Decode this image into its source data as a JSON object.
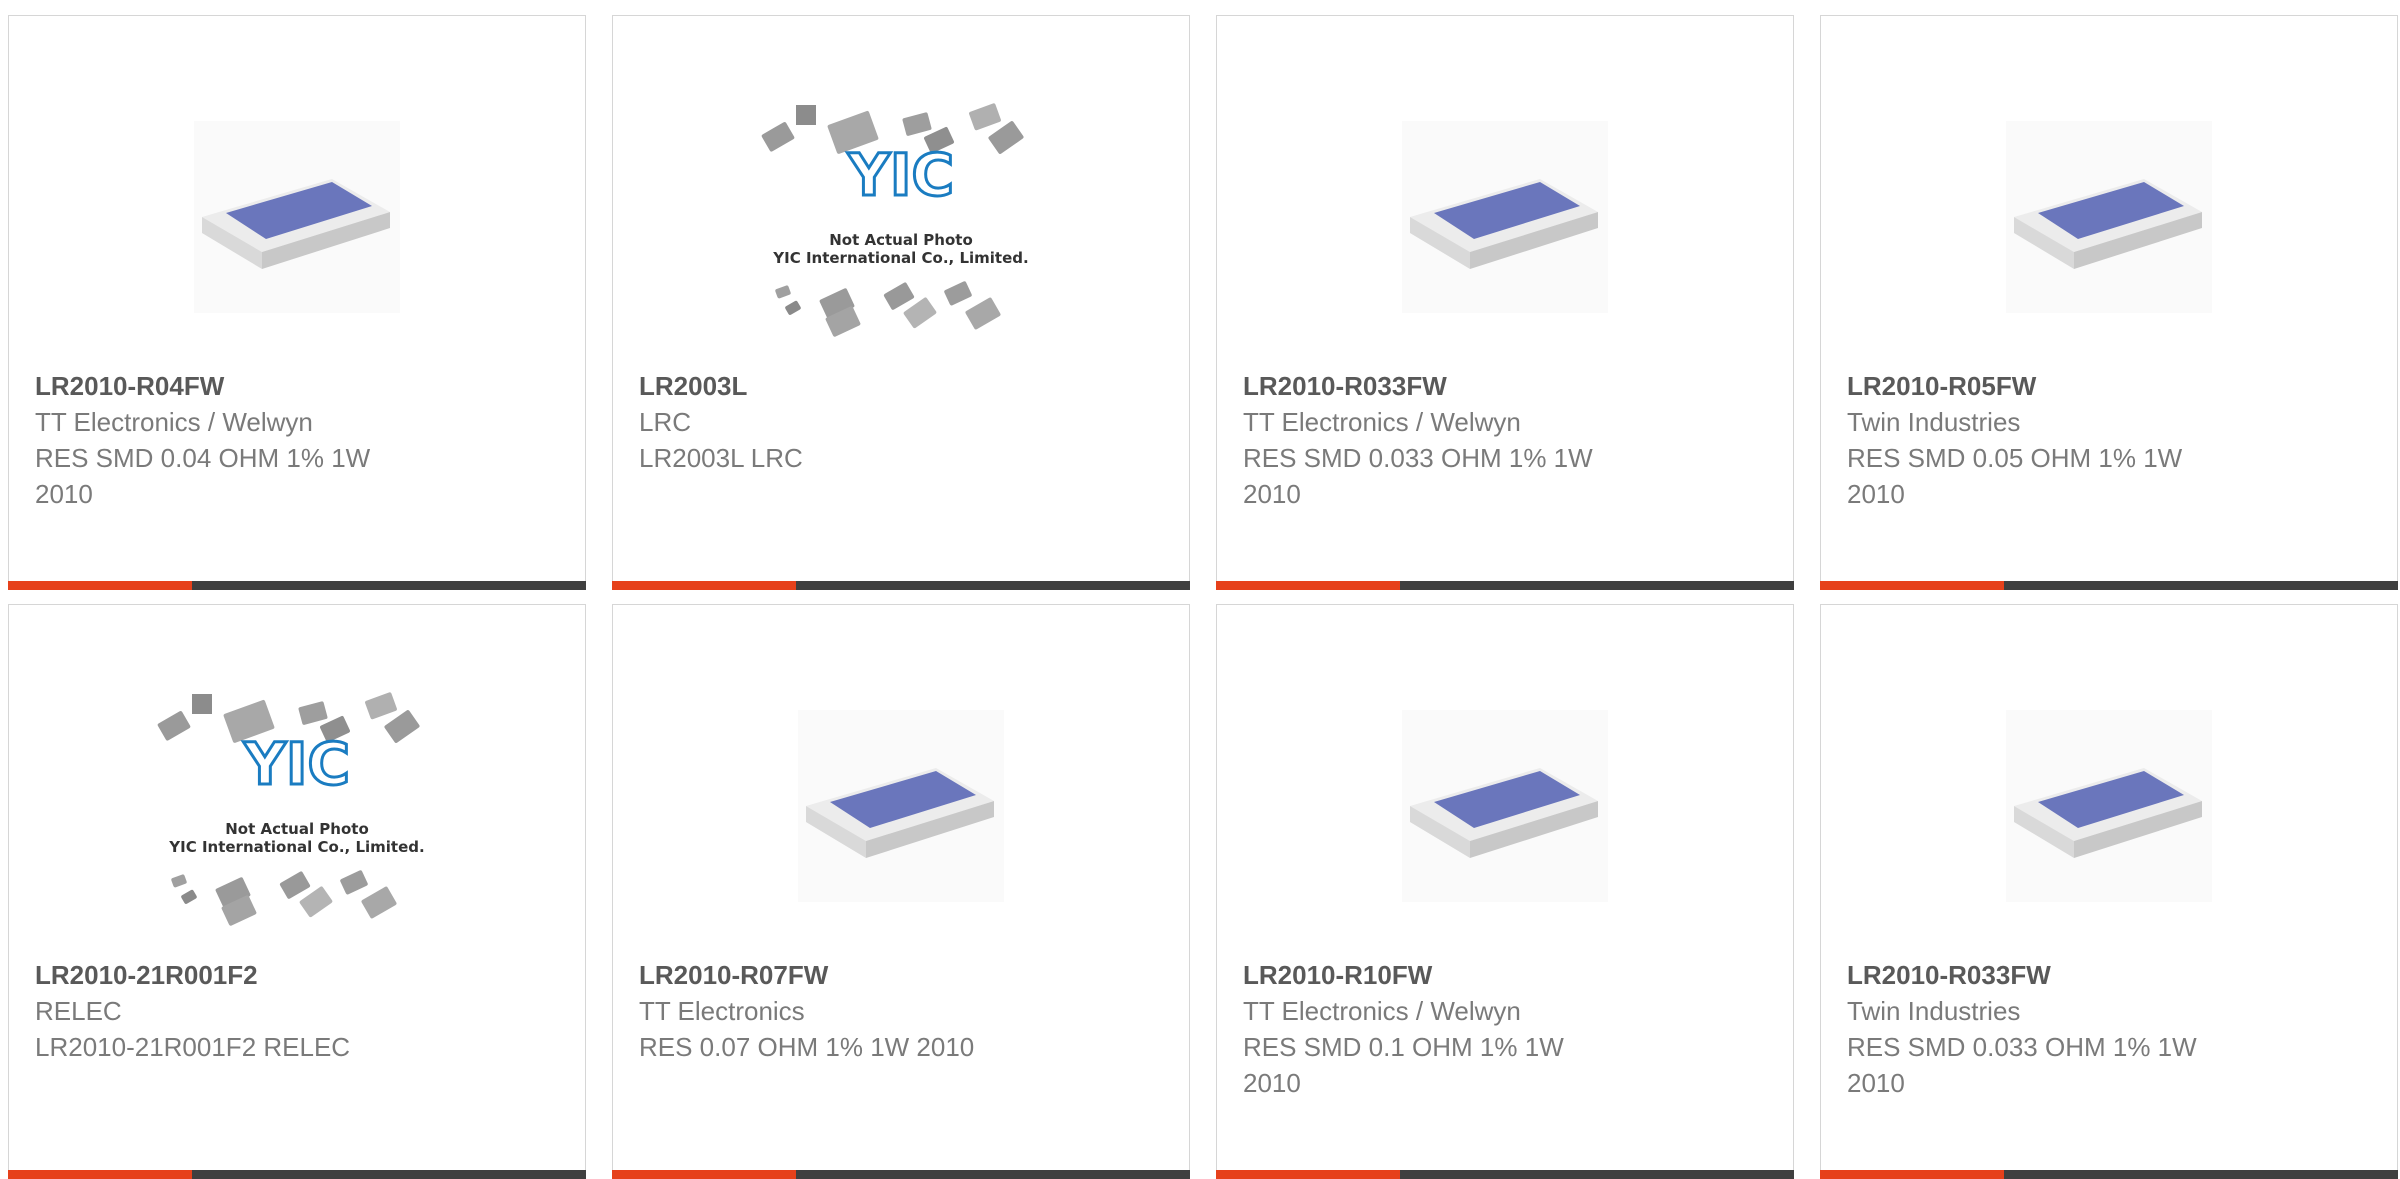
{
  "colors": {
    "accent": "#e6411b",
    "bar": "#3f3f3f",
    "resistor_body": "#6a76bc",
    "yic_logo": "#1a7cc1"
  },
  "placeholder": {
    "line1": "Not Actual Photo",
    "line2": "YIC International Co., Limited.",
    "logo_text": "YIC"
  },
  "products": [
    {
      "part_number": "LR2010-R04FW",
      "manufacturer": "TT Electronics / Welwyn",
      "description": "RES SMD 0.04 OHM 1% 1W 2010",
      "image": "resistor-chip-icon"
    },
    {
      "part_number": "LR2003L",
      "manufacturer": "LRC",
      "description": "LR2003L LRC",
      "image": "not-actual-photo-placeholder"
    },
    {
      "part_number": "LR2010-R033FW",
      "manufacturer": "TT Electronics / Welwyn",
      "description": "RES SMD 0.033 OHM 1% 1W 2010",
      "image": "resistor-chip-icon"
    },
    {
      "part_number": "LR2010-R05FW",
      "manufacturer": "Twin Industries",
      "description": "RES SMD 0.05 OHM 1% 1W 2010",
      "image": "resistor-chip-icon"
    },
    {
      "part_number": "LR2010-21R001F2",
      "manufacturer": "RELEC",
      "description": "LR2010-21R001F2 RELEC",
      "image": "not-actual-photo-placeholder"
    },
    {
      "part_number": "LR2010-R07FW",
      "manufacturer": "TT Electronics",
      "description": "RES 0.07 OHM 1% 1W 2010",
      "image": "resistor-chip-icon"
    },
    {
      "part_number": "LR2010-R10FW",
      "manufacturer": "TT Electronics / Welwyn",
      "description": "RES SMD 0.1 OHM 1% 1W 2010",
      "image": "resistor-chip-icon"
    },
    {
      "part_number": "LR2010-R033FW",
      "manufacturer": "Twin Industries",
      "description": "RES SMD 0.033 OHM 1% 1W 2010",
      "image": "resistor-chip-icon"
    }
  ]
}
